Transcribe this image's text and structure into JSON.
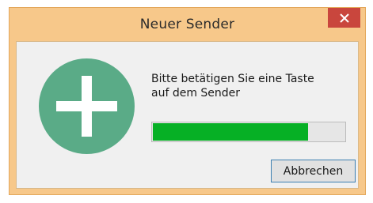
{
  "window": {
    "title": "Neuer Sender",
    "close_glyph": "✕",
    "accent_color": "#f7c88a",
    "close_color": "#c9463d"
  },
  "dialog": {
    "icon": "plus-icon",
    "icon_color": "#5aab87",
    "message_line1": "Bitte betätigen Sie eine Taste",
    "message_line2": "auf dem Sender",
    "progress": {
      "fraction": 0.81,
      "fill_color": "#06b025"
    },
    "cancel_label": "Abbrechen"
  }
}
